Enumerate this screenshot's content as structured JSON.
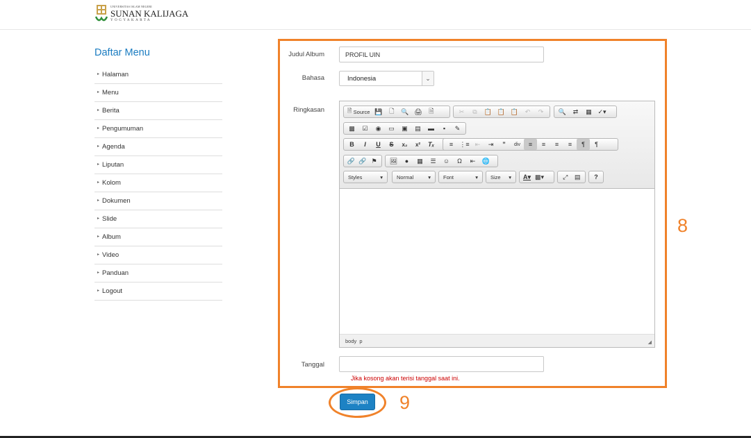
{
  "logo": {
    "line1": "UNIVERSITAS ISLAM NEGERI",
    "line2": "SUNAN KALIJAGA",
    "line3": "YOGYAKARTA"
  },
  "sidebar": {
    "title": "Daftar Menu",
    "items": [
      "Halaman",
      "Menu",
      "Berita",
      "Pengumuman",
      "Agenda",
      "Liputan",
      "Kolom",
      "Dokumen",
      "Slide",
      "Album",
      "Video",
      "Panduan",
      "Logout"
    ]
  },
  "form": {
    "judul_label": "Judul Album",
    "judul_value": "PROFIL UIN",
    "bahasa_label": "Bahasa",
    "bahasa_value": "Indonesia",
    "ringkasan_label": "Ringkasan",
    "tanggal_label": "Tanggal",
    "tanggal_value": "",
    "tanggal_hint": "Jika kosong akan terisi tanggal saat ini.",
    "save_label": "Simpan"
  },
  "editor": {
    "source_label": "Source",
    "styles_label": "Styles",
    "format_label": "Normal",
    "font_label": "Font",
    "size_label": "Size",
    "help_label": "?",
    "status_path": "body  p"
  },
  "annotations": {
    "frame_number": "8",
    "button_number": "9",
    "color": "#f0822a"
  },
  "colors": {
    "accent": "#1a7cc1",
    "button": "#1d82c4",
    "hint": "#cc0000"
  }
}
